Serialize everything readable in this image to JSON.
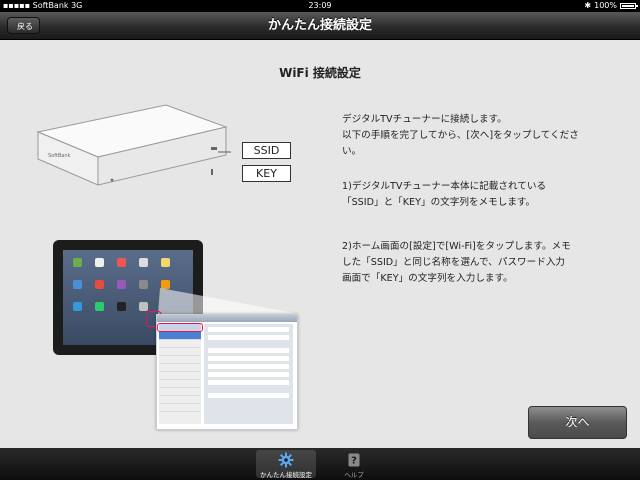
{
  "status": {
    "carrier": "SoftBank",
    "network": "3G",
    "time": "23:09",
    "battery": "100%"
  },
  "nav": {
    "back_label": "戻る",
    "title": "かんたん接続設定"
  },
  "main": {
    "heading": "WiFi 接続設定",
    "device_logo": "SoftBank",
    "label_ssid": "SSID",
    "label_key": "KEY",
    "paragraph1_line1": "デジタルTVチューナーに接続します。",
    "paragraph1_line2": "以下の手順を完了してから、[次へ]をタップしてくださ",
    "paragraph1_line3": "い。",
    "step1_line1": "1)デジタルTVチューナー本体に記載されている",
    "step1_line2": "「SSID」と「KEY」の文字列をメモします。",
    "step2_line1": "2)ホーム画面の[設定]で[Wi-Fi]をタップします。メモ",
    "step2_line2": "した「SSID」と同じ名称を選んで、パスワード入力",
    "step2_line3": "画面で「KEY」の文字列を入力します。",
    "next_label": "次へ"
  },
  "tabs": [
    {
      "label": "かんたん接続設定",
      "icon": "gear-icon",
      "active": true
    },
    {
      "label": "ヘルプ",
      "icon": "help-icon",
      "active": false
    }
  ]
}
